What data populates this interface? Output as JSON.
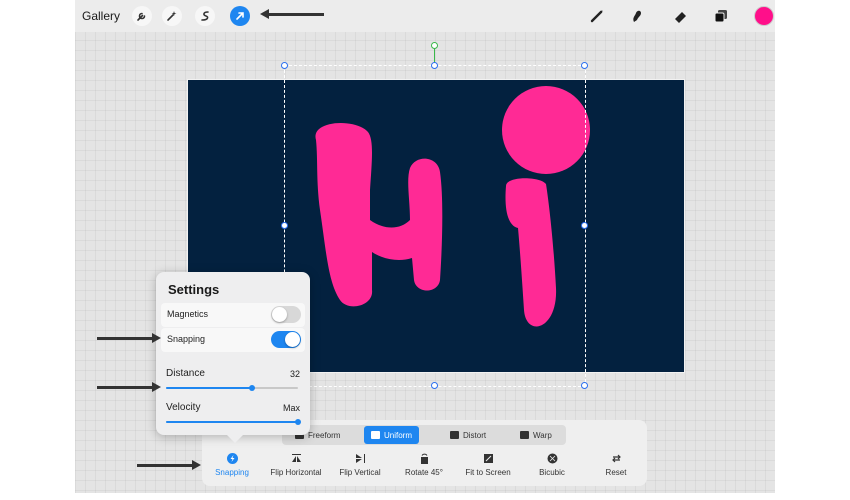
{
  "topbar": {
    "gallery_label": "Gallery",
    "left_tools": [
      "wrench-icon",
      "magic-wand-icon",
      "selection-icon",
      "transform-arrow-icon"
    ],
    "right_tools": [
      "brush-icon",
      "smudge-icon",
      "eraser-icon",
      "layers-icon"
    ],
    "active_color": "#ff0f8a"
  },
  "canvas": {
    "text": "Hi",
    "background": "#03213f",
    "text_color": "#ff2a95"
  },
  "settings": {
    "title": "Settings",
    "magnetics_label": "Magnetics",
    "magnetics_on": false,
    "snapping_label": "Snapping",
    "snapping_on": true,
    "distance_label": "Distance",
    "distance_value": "32",
    "distance_fraction": 0.65,
    "velocity_label": "Velocity",
    "velocity_value": "Max",
    "velocity_fraction": 1.0
  },
  "transform_modes": [
    {
      "label": "Freeform",
      "active": false
    },
    {
      "label": "Uniform",
      "active": true
    },
    {
      "label": "Distort",
      "active": false
    },
    {
      "label": "Warp",
      "active": false
    }
  ],
  "actions": [
    {
      "label": "Snapping",
      "icon": "snapping-icon",
      "active": true
    },
    {
      "label": "Flip Horizontal",
      "icon": "flip-horizontal-icon",
      "active": false
    },
    {
      "label": "Flip Vertical",
      "icon": "flip-vertical-icon",
      "active": false
    },
    {
      "label": "Rotate 45°",
      "icon": "rotate-icon",
      "active": false
    },
    {
      "label": "Fit to Screen",
      "icon": "fit-to-screen-icon",
      "active": false
    },
    {
      "label": "Bicubic",
      "icon": "bicubic-icon",
      "active": false
    },
    {
      "label": "Reset",
      "icon": "reset-icon",
      "active": false
    }
  ],
  "colors": {
    "accent": "#1e86f0"
  }
}
